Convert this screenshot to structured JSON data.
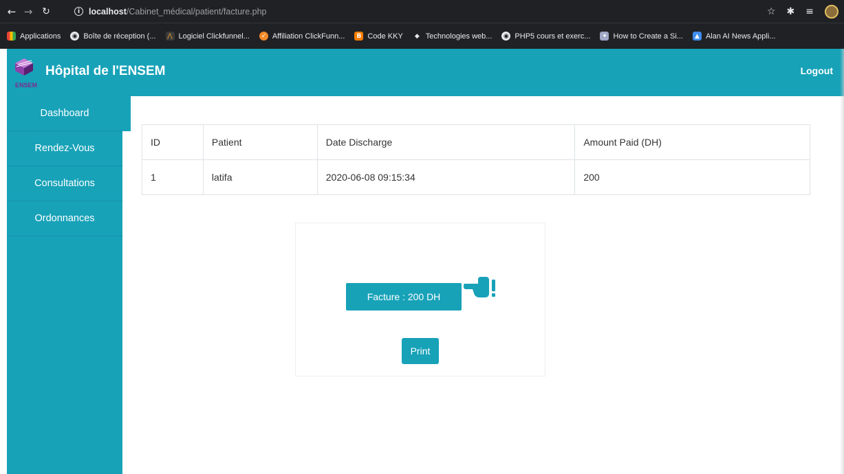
{
  "browser": {
    "url_host": "localhost",
    "url_path": "/Cabinet_médical/patient/facture.php",
    "bookmarks": [
      {
        "label": "Applications",
        "icon": "apps-grid-icon"
      },
      {
        "label": "Boîte de réception (...",
        "icon": "globe-icon"
      },
      {
        "label": "Logiciel Clickfunnel...",
        "icon": "clickfunnels-icon"
      },
      {
        "label": "Affiliation ClickFunn...",
        "icon": "shield-icon"
      },
      {
        "label": "Code KKY",
        "icon": "blogger-icon"
      },
      {
        "label": "Technologies web...",
        "icon": "site-icon"
      },
      {
        "label": "PHP5 cours et exerc...",
        "icon": "globe-icon"
      },
      {
        "label": "How to Create a Si...",
        "icon": "site-icon"
      },
      {
        "label": "Alan AI News Appli...",
        "icon": "alan-icon"
      }
    ]
  },
  "header": {
    "logo_text": "ENSEM",
    "title": "Hôpital de l'ENSEM",
    "logout": "Logout"
  },
  "sidebar": {
    "items": [
      {
        "label": "Dashboard"
      },
      {
        "label": "Rendez-Vous"
      },
      {
        "label": "Consultations"
      },
      {
        "label": "Ordonnances"
      }
    ]
  },
  "table": {
    "headers": [
      "ID",
      "Patient",
      "Date Discharge",
      "Amount Paid (DH)"
    ],
    "rows": [
      [
        "1",
        "latifa",
        "2020-06-08 09:15:34",
        "200"
      ]
    ]
  },
  "invoice": {
    "facture_label": "Facture : 200 DH",
    "print_label": "Print"
  },
  "colors": {
    "accent": "#17a2b8",
    "chrome": "#202124"
  }
}
